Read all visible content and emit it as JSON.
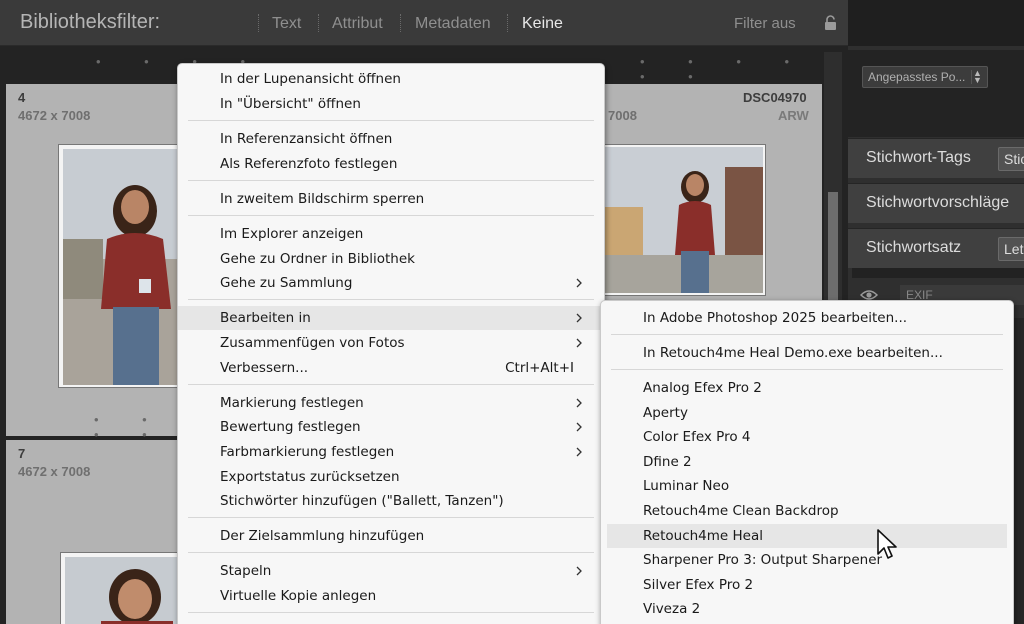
{
  "filter_bar": {
    "title": "Bibliotheksfilter:",
    "tabs": [
      "Text",
      "Attribut",
      "Metadaten",
      "Keine"
    ],
    "active_tab": "Keine",
    "filter_off": "Filter aus"
  },
  "grid": {
    "cells": [
      {
        "index": "4",
        "dimensions": "4672 x 7008"
      },
      {
        "index": "",
        "dimensions": "7008",
        "filename": "DSC04970",
        "extension": "ARW"
      },
      {
        "index": "7",
        "dimensions": "4672 x 7008"
      }
    ]
  },
  "right_panel": {
    "preset": "Angepasstes Po...",
    "sections": [
      {
        "label": "Stichwort-Tags",
        "chip": "Stic"
      },
      {
        "label": "Stichwortvorschläge"
      },
      {
        "label": "Stichwortsatz",
        "chip": "Let"
      }
    ],
    "exif": "EXIF"
  },
  "context_menu": {
    "items": [
      {
        "label": "In der Lupenansicht öffnen"
      },
      {
        "label": "In \"Übersicht\" öffnen"
      },
      {
        "label": "In Referenzansicht öffnen"
      },
      {
        "label": "Als Referenzfoto festlegen"
      },
      {
        "label": "In zweitem Bildschirm sperren"
      },
      {
        "label": "Im Explorer anzeigen"
      },
      {
        "label": "Gehe zu Ordner in Bibliothek"
      },
      {
        "label": "Gehe zu Sammlung",
        "submenu": true
      },
      {
        "label": "Bearbeiten in",
        "submenu": true,
        "highlighted": true
      },
      {
        "label": "Zusammenfügen von Fotos",
        "submenu": true
      },
      {
        "label": "Verbessern...",
        "shortcut": "Ctrl+Alt+I"
      },
      {
        "label": "Markierung festlegen",
        "submenu": true
      },
      {
        "label": "Bewertung festlegen",
        "submenu": true
      },
      {
        "label": "Farbmarkierung festlegen",
        "submenu": true
      },
      {
        "label": "Exportstatus zurücksetzen"
      },
      {
        "label": "Stichwörter hinzufügen (\"Ballett, Tanzen\")"
      },
      {
        "label": "Der Zielsammlung hinzufügen"
      },
      {
        "label": "Stapeln",
        "submenu": true
      },
      {
        "label": "Virtuelle Kopie anlegen"
      }
    ]
  },
  "edit_in_submenu": {
    "items": [
      {
        "label": "In Adobe Photoshop 2025 bearbeiten..."
      },
      {
        "label": "In Retouch4me Heal Demo.exe bearbeiten..."
      },
      {
        "label": "Analog Efex Pro 2"
      },
      {
        "label": "Aperty"
      },
      {
        "label": "Color Efex Pro 4"
      },
      {
        "label": "Dfine 2"
      },
      {
        "label": "Luminar Neo"
      },
      {
        "label": "Retouch4me Clean Backdrop"
      },
      {
        "label": "Retouch4me Heal",
        "highlighted": true
      },
      {
        "label": "Sharpener Pro 3: Output Sharpener"
      },
      {
        "label": "Silver Efex Pro 2"
      },
      {
        "label": "Viveza 2"
      }
    ]
  },
  "colors": {
    "menu_bg": "#f7f7f7",
    "menu_highlight": "#e6e6e6",
    "cell_bg": "#b3b3b3",
    "panel_header": "#404040"
  },
  "icons": [
    "lock-icon",
    "chevron-right-icon",
    "eye-icon",
    "stepper-icon",
    "mouse-cursor-icon"
  ]
}
